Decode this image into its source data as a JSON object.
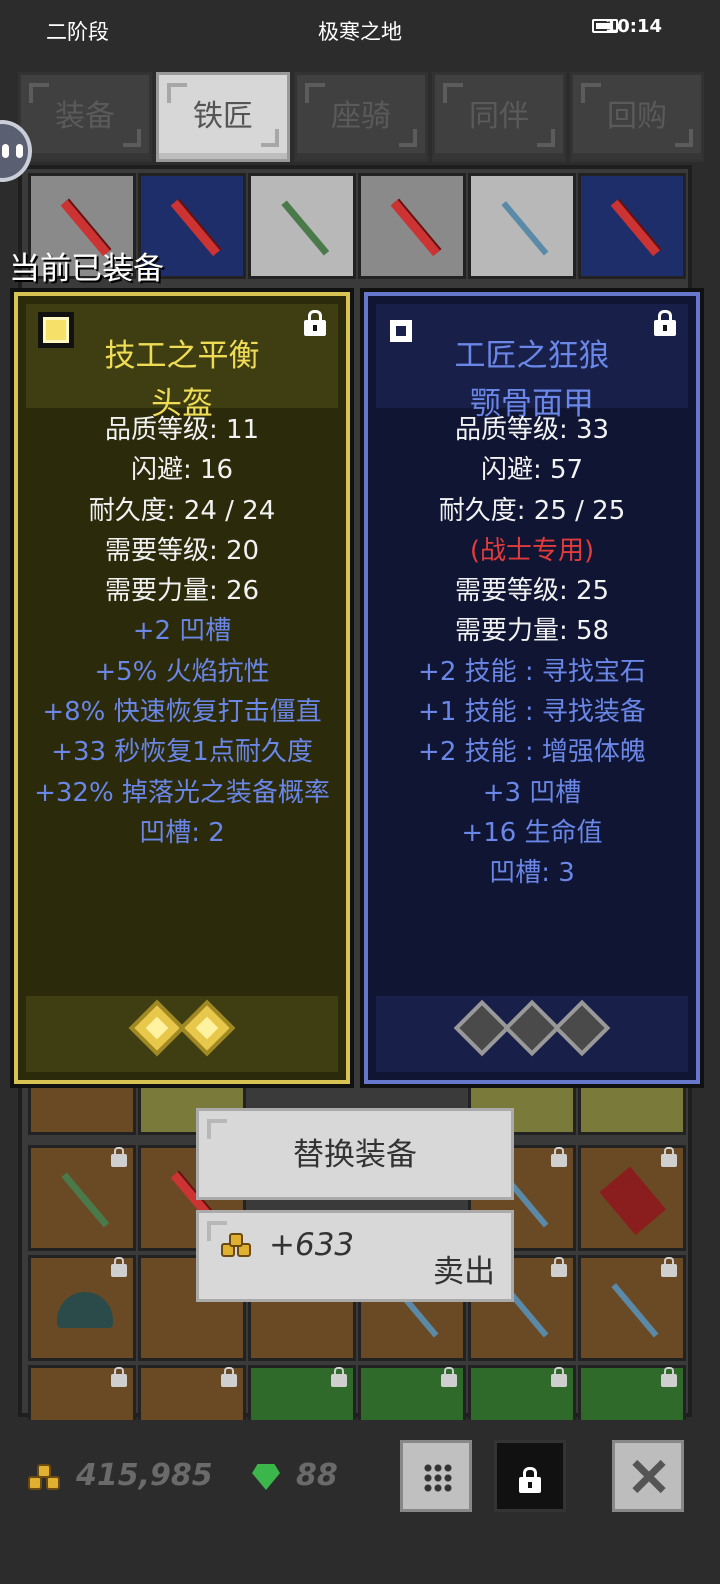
{
  "status": {
    "left": "二阶段",
    "title": "极寒之地",
    "time": "10:14"
  },
  "tabs": [
    {
      "label": "装备",
      "active": false
    },
    {
      "label": "铁匠",
      "active": true
    },
    {
      "label": "座骑",
      "active": false
    },
    {
      "label": "同伴",
      "active": false
    },
    {
      "label": "回购",
      "active": false
    }
  ],
  "current_label": "当前已装备",
  "left_card": {
    "title1": "技工之平衡",
    "title2": "头盔",
    "color": "#eedc55",
    "lines": [
      {
        "text": "品质等级: 11",
        "style": "white"
      },
      {
        "text": "闪避: 16",
        "style": "white"
      },
      {
        "text": "耐久度: 24 / 24",
        "style": "white"
      },
      {
        "text": "需要等级: 20",
        "style": "white"
      },
      {
        "text": "需要力量: 26",
        "style": "white"
      },
      {
        "text": "+2 凹槽",
        "style": "blue"
      },
      {
        "text": "+5% 火焰抗性",
        "style": "blue"
      },
      {
        "text": "+8% 快速恢复打击僵直",
        "style": "blue"
      },
      {
        "text": "+33 秒恢复1点耐久度",
        "style": "blue"
      },
      {
        "text": "+32% 掉落光之装备概率",
        "style": "blue"
      },
      {
        "text": "凹槽: 2",
        "style": "blue"
      }
    ],
    "sockets": [
      "gold",
      "gold"
    ]
  },
  "right_card": {
    "title1": "工匠之狂狼",
    "title2": "颚骨面甲",
    "color": "#6a86e6",
    "lines": [
      {
        "text": "品质等级: 33",
        "style": "white"
      },
      {
        "text": "闪避: 57",
        "style": "white"
      },
      {
        "text": "耐久度: 25 / 25",
        "style": "white"
      },
      {
        "text": "(战士专用)",
        "style": "red"
      },
      {
        "text": "需要等级: 25",
        "style": "white"
      },
      {
        "text": "需要力量: 58",
        "style": "white"
      },
      {
        "text": "+2 技能 : 寻找宝石",
        "style": "blue"
      },
      {
        "text": "+1 技能 : 寻找装备",
        "style": "blue"
      },
      {
        "text": "+2 技能 : 增强体魄",
        "style": "blue"
      },
      {
        "text": "+3 凹槽",
        "style": "blue"
      },
      {
        "text": "+16 生命值",
        "style": "blue"
      },
      {
        "text": "凹槽: 3",
        "style": "blue"
      }
    ],
    "sockets": [
      "empty",
      "empty",
      "empty"
    ]
  },
  "actions": {
    "replace": "替换装备",
    "sell_amount": "+633",
    "sell": "卖出"
  },
  "footer": {
    "gold": "415,985",
    "gems": "88"
  },
  "icons": [
    "face-icon",
    "padlock-icon",
    "gold-coins-icon",
    "gem-icon",
    "grid-icon",
    "close-icon"
  ]
}
